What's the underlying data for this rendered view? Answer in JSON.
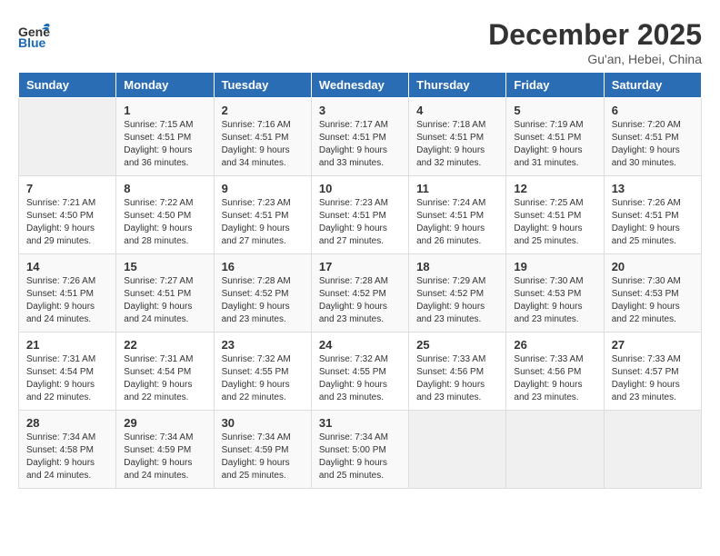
{
  "header": {
    "logo_general": "General",
    "logo_blue": "Blue",
    "month_title": "December 2025",
    "subtitle": "Gu'an, Hebei, China"
  },
  "weekdays": [
    "Sunday",
    "Monday",
    "Tuesday",
    "Wednesday",
    "Thursday",
    "Friday",
    "Saturday"
  ],
  "weeks": [
    [
      {
        "day": "",
        "info": ""
      },
      {
        "day": "1",
        "info": "Sunrise: 7:15 AM\nSunset: 4:51 PM\nDaylight: 9 hours\nand 36 minutes."
      },
      {
        "day": "2",
        "info": "Sunrise: 7:16 AM\nSunset: 4:51 PM\nDaylight: 9 hours\nand 34 minutes."
      },
      {
        "day": "3",
        "info": "Sunrise: 7:17 AM\nSunset: 4:51 PM\nDaylight: 9 hours\nand 33 minutes."
      },
      {
        "day": "4",
        "info": "Sunrise: 7:18 AM\nSunset: 4:51 PM\nDaylight: 9 hours\nand 32 minutes."
      },
      {
        "day": "5",
        "info": "Sunrise: 7:19 AM\nSunset: 4:51 PM\nDaylight: 9 hours\nand 31 minutes."
      },
      {
        "day": "6",
        "info": "Sunrise: 7:20 AM\nSunset: 4:51 PM\nDaylight: 9 hours\nand 30 minutes."
      }
    ],
    [
      {
        "day": "7",
        "info": "Sunrise: 7:21 AM\nSunset: 4:50 PM\nDaylight: 9 hours\nand 29 minutes."
      },
      {
        "day": "8",
        "info": "Sunrise: 7:22 AM\nSunset: 4:50 PM\nDaylight: 9 hours\nand 28 minutes."
      },
      {
        "day": "9",
        "info": "Sunrise: 7:23 AM\nSunset: 4:51 PM\nDaylight: 9 hours\nand 27 minutes."
      },
      {
        "day": "10",
        "info": "Sunrise: 7:23 AM\nSunset: 4:51 PM\nDaylight: 9 hours\nand 27 minutes."
      },
      {
        "day": "11",
        "info": "Sunrise: 7:24 AM\nSunset: 4:51 PM\nDaylight: 9 hours\nand 26 minutes."
      },
      {
        "day": "12",
        "info": "Sunrise: 7:25 AM\nSunset: 4:51 PM\nDaylight: 9 hours\nand 25 minutes."
      },
      {
        "day": "13",
        "info": "Sunrise: 7:26 AM\nSunset: 4:51 PM\nDaylight: 9 hours\nand 25 minutes."
      }
    ],
    [
      {
        "day": "14",
        "info": "Sunrise: 7:26 AM\nSunset: 4:51 PM\nDaylight: 9 hours\nand 24 minutes."
      },
      {
        "day": "15",
        "info": "Sunrise: 7:27 AM\nSunset: 4:51 PM\nDaylight: 9 hours\nand 24 minutes."
      },
      {
        "day": "16",
        "info": "Sunrise: 7:28 AM\nSunset: 4:52 PM\nDaylight: 9 hours\nand 23 minutes."
      },
      {
        "day": "17",
        "info": "Sunrise: 7:28 AM\nSunset: 4:52 PM\nDaylight: 9 hours\nand 23 minutes."
      },
      {
        "day": "18",
        "info": "Sunrise: 7:29 AM\nSunset: 4:52 PM\nDaylight: 9 hours\nand 23 minutes."
      },
      {
        "day": "19",
        "info": "Sunrise: 7:30 AM\nSunset: 4:53 PM\nDaylight: 9 hours\nand 23 minutes."
      },
      {
        "day": "20",
        "info": "Sunrise: 7:30 AM\nSunset: 4:53 PM\nDaylight: 9 hours\nand 22 minutes."
      }
    ],
    [
      {
        "day": "21",
        "info": "Sunrise: 7:31 AM\nSunset: 4:54 PM\nDaylight: 9 hours\nand 22 minutes."
      },
      {
        "day": "22",
        "info": "Sunrise: 7:31 AM\nSunset: 4:54 PM\nDaylight: 9 hours\nand 22 minutes."
      },
      {
        "day": "23",
        "info": "Sunrise: 7:32 AM\nSunset: 4:55 PM\nDaylight: 9 hours\nand 22 minutes."
      },
      {
        "day": "24",
        "info": "Sunrise: 7:32 AM\nSunset: 4:55 PM\nDaylight: 9 hours\nand 23 minutes."
      },
      {
        "day": "25",
        "info": "Sunrise: 7:33 AM\nSunset: 4:56 PM\nDaylight: 9 hours\nand 23 minutes."
      },
      {
        "day": "26",
        "info": "Sunrise: 7:33 AM\nSunset: 4:56 PM\nDaylight: 9 hours\nand 23 minutes."
      },
      {
        "day": "27",
        "info": "Sunrise: 7:33 AM\nSunset: 4:57 PM\nDaylight: 9 hours\nand 23 minutes."
      }
    ],
    [
      {
        "day": "28",
        "info": "Sunrise: 7:34 AM\nSunset: 4:58 PM\nDaylight: 9 hours\nand 24 minutes."
      },
      {
        "day": "29",
        "info": "Sunrise: 7:34 AM\nSunset: 4:59 PM\nDaylight: 9 hours\nand 24 minutes."
      },
      {
        "day": "30",
        "info": "Sunrise: 7:34 AM\nSunset: 4:59 PM\nDaylight: 9 hours\nand 25 minutes."
      },
      {
        "day": "31",
        "info": "Sunrise: 7:34 AM\nSunset: 5:00 PM\nDaylight: 9 hours\nand 25 minutes."
      },
      {
        "day": "",
        "info": ""
      },
      {
        "day": "",
        "info": ""
      },
      {
        "day": "",
        "info": ""
      }
    ]
  ]
}
